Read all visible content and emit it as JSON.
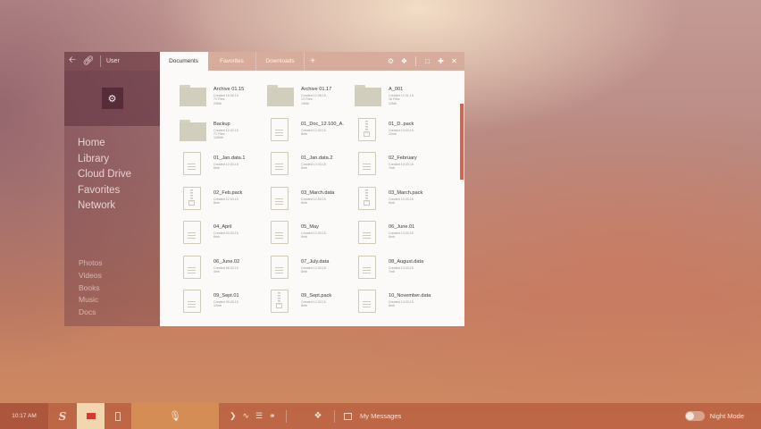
{
  "sidebar": {
    "user_label": "User",
    "main_nav": [
      "Home",
      "Library",
      "Cloud Drive",
      "Favorites",
      "Network"
    ],
    "sub_nav": [
      "Photos",
      "Videos",
      "Books",
      "Music",
      "Docs"
    ]
  },
  "tabs": [
    {
      "label": "Documents",
      "active": true
    },
    {
      "label": "Favorites",
      "active": false
    },
    {
      "label": "Downloads",
      "active": false
    }
  ],
  "new_tab_glyph": "+",
  "toolbar_icons": [
    "gear-icon",
    "layers-icon",
    "maximize-icon",
    "add-icon",
    "close-icon"
  ],
  "colors": {
    "scroll_accent": "#d9624e",
    "active_taskbar": "#f1d6ae",
    "folder_red": "#d63a2a"
  },
  "files": [
    {
      "name": "Archive 01.15",
      "type": "folder",
      "meta": [
        "Created 15.06.15",
        "71 Files",
        "23Mb"
      ]
    },
    {
      "name": "Archive 01.17",
      "type": "folder",
      "meta": [
        "Created 12.08.15",
        "13 Files",
        "19Mb"
      ]
    },
    {
      "name": "A_001",
      "type": "folder",
      "meta": [
        "Created 12.01.15",
        "16 Files",
        "12Mb"
      ]
    },
    {
      "name": "Backup",
      "type": "folder",
      "meta": [
        "Created 12.02.15",
        "71 Files",
        "128Mb"
      ]
    },
    {
      "name": "01_Doc_12.100_A.",
      "type": "doc",
      "meta": [
        "Created 12.03.15",
        "8mb"
      ]
    },
    {
      "name": "01_D..pack",
      "type": "zip",
      "meta": [
        "Created 13.03.15",
        "12mb"
      ]
    },
    {
      "name": "01_Jan.data.1",
      "type": "doc",
      "meta": [
        "Created 12.03.15",
        "8mb"
      ]
    },
    {
      "name": "01_Jan.data.2",
      "type": "doc",
      "meta": [
        "Created 12.03.15",
        "8mb"
      ]
    },
    {
      "name": "02_February",
      "type": "doc",
      "meta": [
        "Created 13.03.15",
        "7mb"
      ]
    },
    {
      "name": "02_Feb.pack",
      "type": "zip",
      "meta": [
        "Created 12.03.15",
        "8mb"
      ]
    },
    {
      "name": "03_March.data",
      "type": "doc",
      "meta": [
        "Created 12.03.15",
        "8mb"
      ]
    },
    {
      "name": "03_March.pack",
      "type": "zip",
      "meta": [
        "Created 13.03.15",
        "8mb"
      ]
    },
    {
      "name": "04_April",
      "type": "doc",
      "meta": [
        "Created 03.03.15",
        "8mb"
      ]
    },
    {
      "name": "05_May",
      "type": "doc",
      "meta": [
        "Created 12.03.15",
        "8mb"
      ]
    },
    {
      "name": "06_June.01",
      "type": "doc",
      "meta": [
        "Created 13.03.15",
        "8mb"
      ]
    },
    {
      "name": "06_June.02",
      "type": "doc",
      "meta": [
        "Created 06.02.15",
        "4mb"
      ]
    },
    {
      "name": "07_July.data",
      "type": "doc",
      "meta": [
        "Created 12.03.15",
        "8mb"
      ]
    },
    {
      "name": "08_August.data",
      "type": "doc",
      "meta": [
        "Created 13.03.15",
        "7mb"
      ]
    },
    {
      "name": "09_Sept.01",
      "type": "doc",
      "meta": [
        "Created 09.06.15",
        "12mb"
      ]
    },
    {
      "name": "09_Sept.pack",
      "type": "zip",
      "meta": [
        "Created 12.03.15",
        "8mb"
      ]
    },
    {
      "name": "10_November.data",
      "type": "doc",
      "meta": [
        "Created 14.03.15",
        "8mb"
      ]
    }
  ],
  "taskbar": {
    "time": "10:17 AM",
    "logo_letter": "S",
    "messages_label": "My Messages",
    "night_mode_label": "Night Mode",
    "night_mode_on": false
  }
}
